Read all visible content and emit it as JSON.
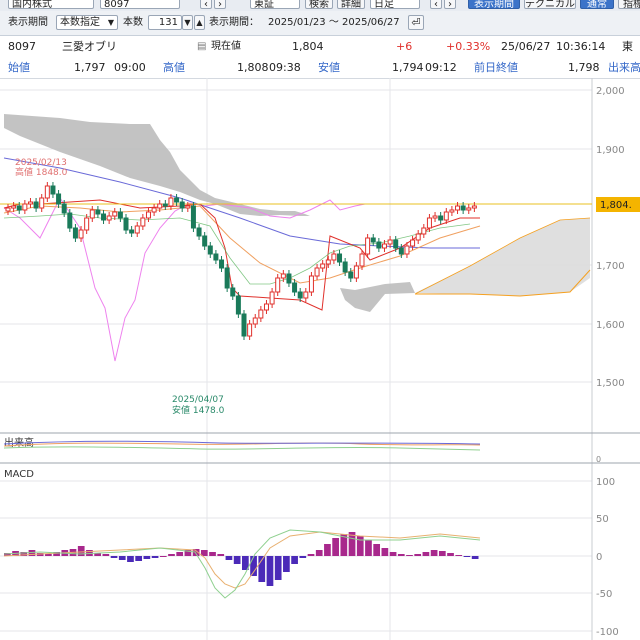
{
  "toolbar": {
    "market_type": "国内株式",
    "code": "8097",
    "exchange": "東証",
    "search_button": "検索",
    "detail_button": "詳細",
    "period_select": "日足",
    "tab_display_period": "表示期間",
    "tab_technical": "テクニカル",
    "tab_normal": "通常",
    "tab_indicator": "指標"
  },
  "period_row": {
    "display_period_label": "表示期間",
    "mode_select": "本数指定",
    "count_label": "本数",
    "count_value": "131",
    "range_label": "表示期間：",
    "range_value": "2025/01/23 ～ 2025/06/27"
  },
  "quote": {
    "code": "8097",
    "name": "三愛オブリ",
    "current_label": "現在値",
    "current_value": "1,804",
    "change": "+6",
    "change_pct": "+0.33%",
    "date": "25/06/27",
    "time": "10:36:14",
    "market_short": "東",
    "open_label": "始値",
    "open_value": "1,797",
    "open_time": "09:00",
    "high_label": "高値",
    "high_value": "1,808",
    "high_time": "09:38",
    "low_label": "安値",
    "low_value": "1,794",
    "low_time": "09:12",
    "prev_close_label": "前日終値",
    "prev_close_value": "1,798",
    "volume_label": "出来高"
  },
  "main_chart": {
    "y_ticks": [
      "2,000",
      "1,900",
      "1,800",
      "1,700",
      "1,600",
      "1,500"
    ],
    "price_tag": "1,804.",
    "high_annotation_date": "2025/02/13",
    "high_annotation_value": "高値 1848.0",
    "low_annotation_date": "2025/04/07",
    "low_annotation_value": "安値 1478.0"
  },
  "volume_panel": {
    "label": "出来高",
    "tick": "0"
  },
  "macd_panel": {
    "label": "MACD",
    "y_ticks": [
      "100",
      "50",
      "0",
      "-50",
      "-100"
    ]
  },
  "colors": {
    "up_candle": "#e0302b",
    "down_candle": "#1a7a5a",
    "cloud": "#b9b9b9",
    "cloud_light": "#dcdcdc",
    "ma_short": "#e0302b",
    "ma_mid": "#f0a060",
    "ma_long": "#6a6ad8",
    "lagging": "#ee82ee",
    "span_b": "#f5a020",
    "price_line": "#e8c020",
    "macd_pos": "#a8288c",
    "macd_neg": "#4b2ab8"
  }
}
